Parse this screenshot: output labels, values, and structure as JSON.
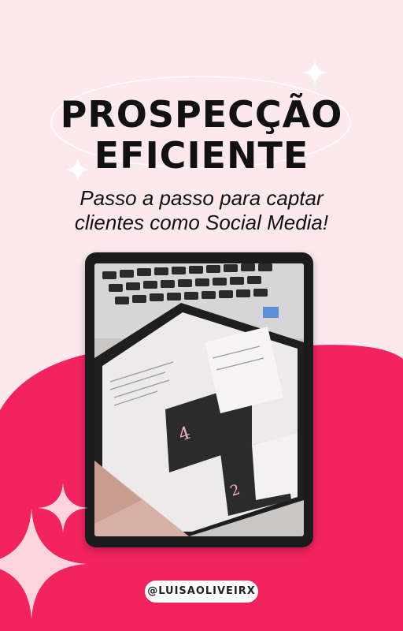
{
  "title": {
    "line1": "PROSPECÇÃO",
    "line2": "EFICIENTE"
  },
  "subtitle": {
    "line1": "Passo a passo para captar",
    "line2": "clientes como Social Media!"
  },
  "handle": "@LUISAOLIVEIRX",
  "colors": {
    "background": "#fbe9ee",
    "accent": "#f2235f",
    "text": "#111111"
  }
}
